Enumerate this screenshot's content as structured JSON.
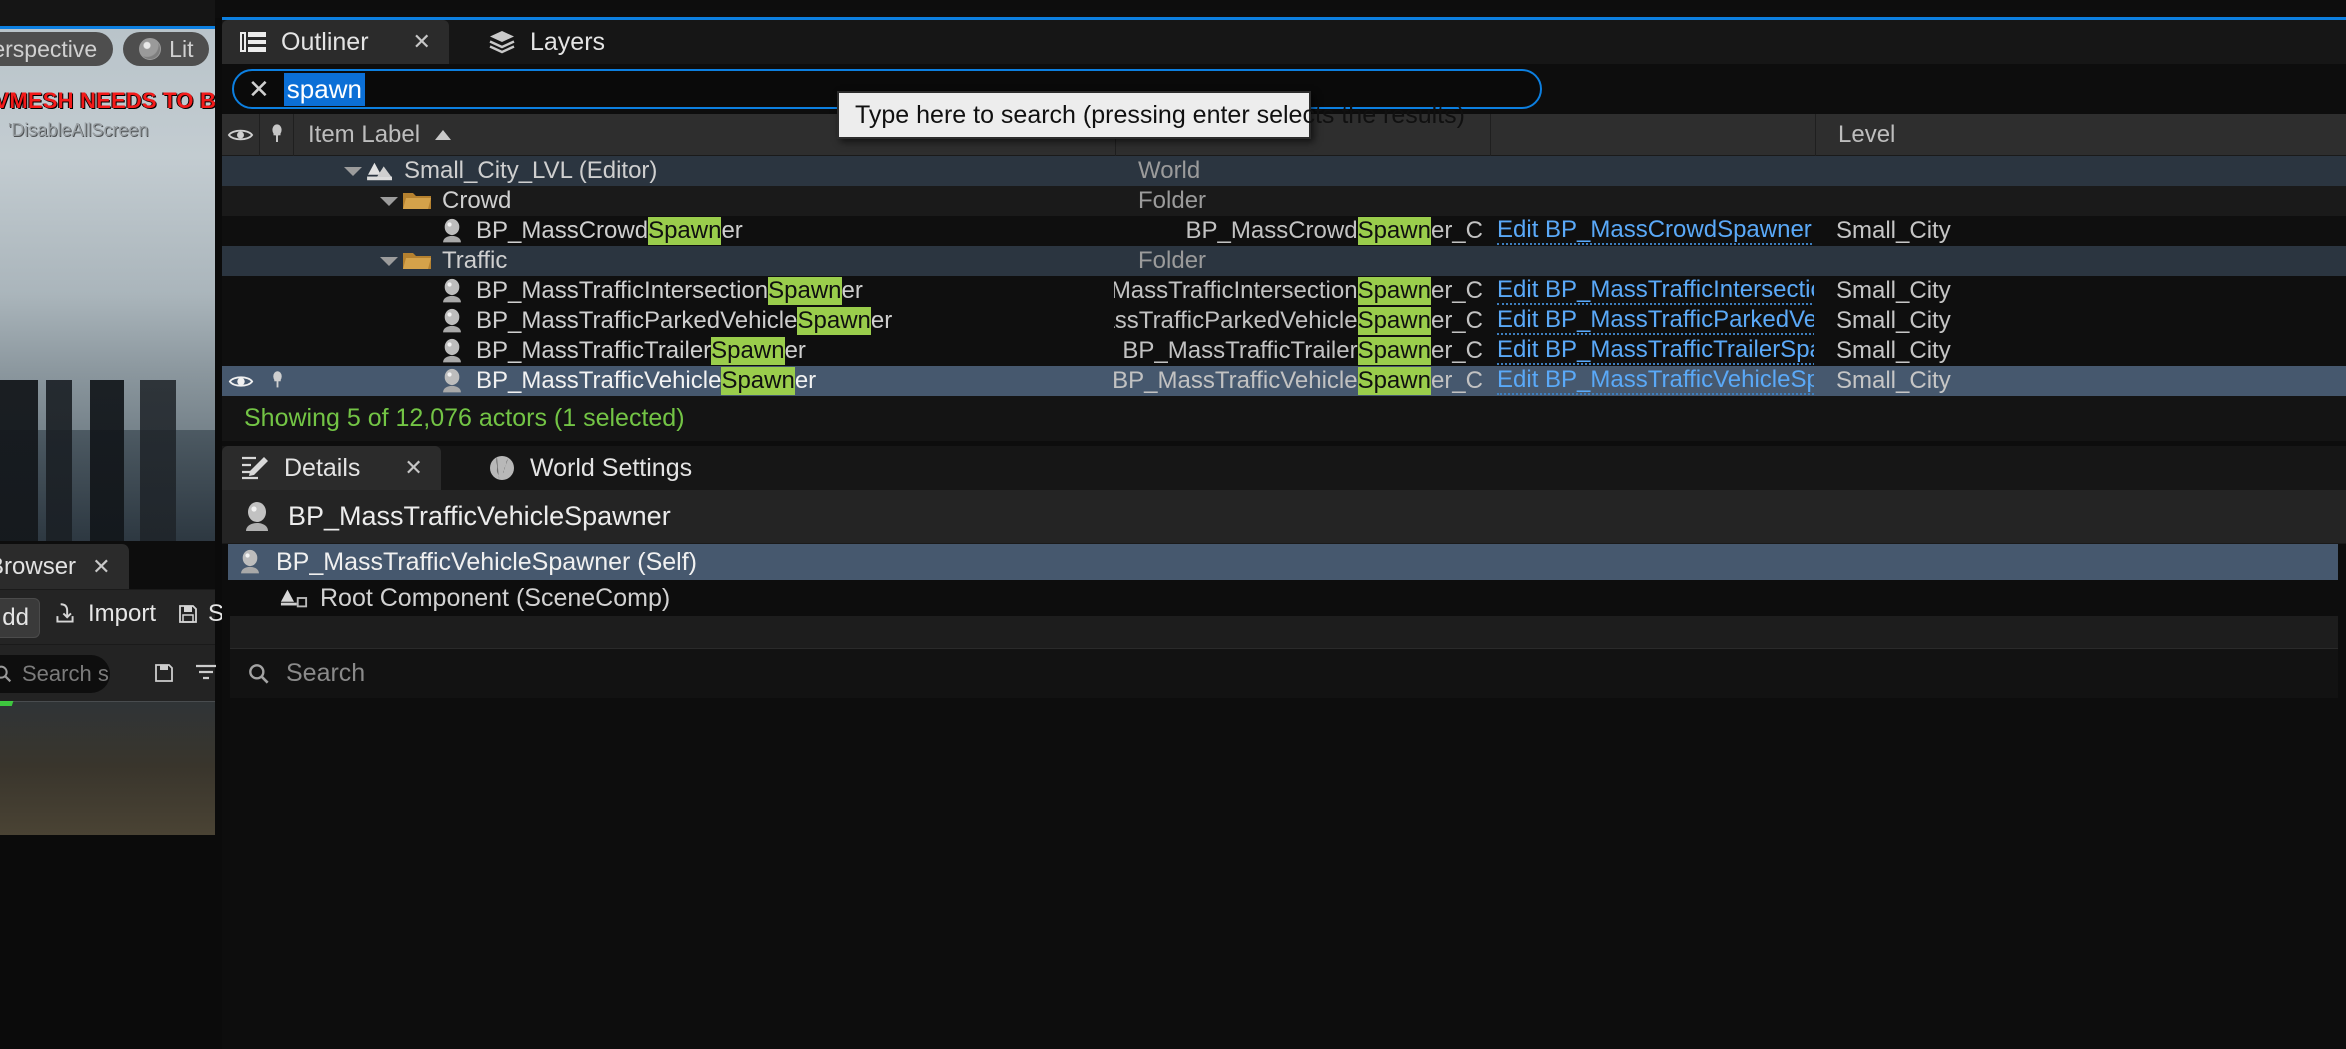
{
  "viewport": {
    "perspective_label": "Perspective",
    "lit_label": "Lit",
    "warning_text": "AVMESH NEEDS TO BE R",
    "warning_sub": "'DisableAllScreen"
  },
  "content_browser": {
    "tab_label": "ent Browser",
    "close_label": "✕",
    "add_label": "dd",
    "import_label": "Import",
    "save_label": "S",
    "search_placeholder": "Search s"
  },
  "outliner": {
    "tabs": [
      {
        "label": "Outliner",
        "icon": "outliner-icon",
        "active": true,
        "closable": true,
        "close_label": "✕"
      },
      {
        "label": "Layers",
        "icon": "layers-icon",
        "active": false,
        "closable": false,
        "close_label": ""
      }
    ],
    "search": {
      "value": "spawn",
      "clear_label": "✕",
      "tooltip": "Type here to search (pressing enter selects the results)"
    },
    "columns": [
      {
        "key": "eye",
        "label": "",
        "icon": "eye-icon"
      },
      {
        "key": "pin",
        "label": "",
        "icon": "pin-icon"
      },
      {
        "key": "item_label",
        "label": "Item Label",
        "sort": "asc"
      },
      {
        "key": "type",
        "label": ""
      },
      {
        "key": "edit",
        "label": ""
      },
      {
        "key": "level",
        "label": "Level"
      }
    ],
    "highlight_term": "Spawn",
    "rows": [
      {
        "kind": "world",
        "indent": 1,
        "icon": "level-icon",
        "twisty": "down",
        "label_pre": "Small_City_LVL (Editor)",
        "label_hl": "",
        "label_post": "",
        "type_pre": "",
        "type_hl": "",
        "type_post": "",
        "edit": "",
        "level": "",
        "type_plain": "World",
        "row_style": "group"
      },
      {
        "kind": "folder",
        "indent": 2,
        "icon": "folder-icon",
        "twisty": "down",
        "label_pre": "Crowd",
        "label_hl": "",
        "label_post": "",
        "type_pre": "",
        "type_hl": "",
        "type_post": "",
        "edit": "",
        "level": "",
        "type_plain": "Folder",
        "row_style": "alt"
      },
      {
        "kind": "actor",
        "indent": 3,
        "icon": "actor-icon",
        "twisty": "",
        "label_pre": "BP_MassCrowd",
        "label_hl": "Spawn",
        "label_post": "er",
        "type_pre": "BP_MassCrowd",
        "type_hl": "Spawn",
        "type_post": "er_C",
        "edit": "Edit BP_MassCrowdSpawner",
        "level": "Small_City",
        "type_plain": "",
        "row_style": "plain"
      },
      {
        "kind": "folder",
        "indent": 2,
        "icon": "folder-icon",
        "twisty": "down",
        "label_pre": "Traffic",
        "label_hl": "",
        "label_post": "",
        "type_pre": "",
        "type_hl": "",
        "type_post": "",
        "edit": "",
        "level": "",
        "type_plain": "Folder",
        "row_style": "group"
      },
      {
        "kind": "actor",
        "indent": 3,
        "icon": "actor-icon",
        "twisty": "",
        "label_pre": "BP_MassTrafficIntersection",
        "label_hl": "Spawn",
        "label_post": "er",
        "type_pre": "BP_MassTrafficIntersection",
        "type_hl": "Spawn",
        "type_post": "er_C",
        "edit": "Edit BP_MassTrafficIntersectionSpa",
        "level": "Small_City",
        "type_plain": "",
        "row_style": "plain"
      },
      {
        "kind": "actor",
        "indent": 3,
        "icon": "actor-icon",
        "twisty": "",
        "label_pre": "BP_MassTrafficParkedVehicle",
        "label_hl": "Spawn",
        "label_post": "er",
        "type_pre": "BP_MassTrafficParkedVehicle",
        "type_hl": "Spawn",
        "type_post": "er_C",
        "edit": "Edit BP_MassTrafficParkedVehicleS",
        "level": "Small_City",
        "type_plain": "",
        "row_style": "plain"
      },
      {
        "kind": "actor",
        "indent": 3,
        "icon": "actor-icon",
        "twisty": "",
        "label_pre": "BP_MassTrafficTrailer",
        "label_hl": "Spawn",
        "label_post": "er",
        "type_pre": "BP_MassTrafficTrailer",
        "type_hl": "Spawn",
        "type_post": "er_C",
        "edit": "Edit BP_MassTrafficTrailerSpawner",
        "level": "Small_City",
        "type_plain": "",
        "row_style": "plain"
      },
      {
        "kind": "actor",
        "indent": 3,
        "icon": "actor-icon",
        "twisty": "",
        "label_pre": "BP_MassTrafficVehicle",
        "label_hl": "Spawn",
        "label_post": "er",
        "type_pre": "BP_MassTrafficVehicle",
        "type_hl": "Spawn",
        "type_post": "er_C",
        "edit": "Edit BP_MassTrafficVehicleSpawne",
        "level": "Small_City",
        "type_plain": "",
        "row_style": "selected"
      }
    ],
    "status": "Showing 5 of 12,076 actors (1 selected)"
  },
  "details": {
    "tabs": [
      {
        "label": "Details",
        "icon": "details-icon",
        "active": true,
        "closable": true,
        "close_label": "✕"
      },
      {
        "label": "World Settings",
        "icon": "world-icon",
        "active": false,
        "closable": false,
        "close_label": ""
      }
    ],
    "selected_actor": "BP_MassTrafficVehicleSpawner",
    "components": [
      {
        "label": "BP_MassTrafficVehicleSpawner (Self)",
        "icon": "actor-icon",
        "selected": true,
        "indent": 0
      },
      {
        "label": "Root Component (SceneComp)",
        "icon": "scene-comp-icon",
        "selected": false,
        "indent": 1
      }
    ],
    "search_placeholder": "Search"
  },
  "colors": {
    "accent_blue": "#0c7fe0",
    "highlight_green": "#9acd4c",
    "status_green": "#73c445",
    "link_blue": "#5aa9f8",
    "selection_blue": "#46586e",
    "warning_red": "#f31a1a"
  }
}
